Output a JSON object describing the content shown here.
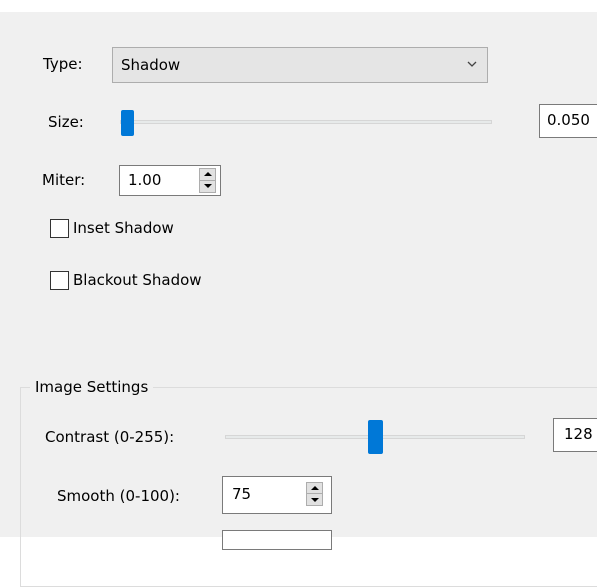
{
  "shadow": {
    "type_label": "Type:",
    "type_value": "Shadow",
    "size_label": "Size:",
    "size_value": "0.050",
    "size_slider_fraction": 0.02,
    "miter_label": "Miter:",
    "miter_value": "1.00",
    "inset_label": "Inset Shadow",
    "inset_checked": false,
    "blackout_label": "Blackout Shadow",
    "blackout_checked": false
  },
  "image_settings": {
    "title": "Image Settings",
    "contrast_label": "Contrast (0-255):",
    "contrast_value": "128",
    "contrast_slider_fraction": 0.5,
    "smooth_label": "Smooth (0-100):",
    "smooth_value": "75"
  },
  "icons": [
    "chevron-down-icon",
    "spin-up-icon",
    "spin-down-icon"
  ],
  "colors": {
    "accent": "#0078d7",
    "panel_bg": "#f0f0f0"
  }
}
